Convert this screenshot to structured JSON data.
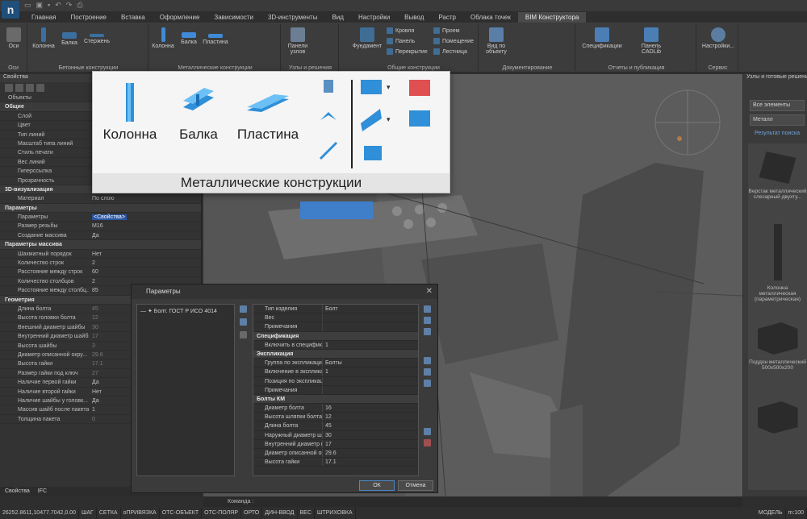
{
  "ribbon": {
    "tabs": [
      "Главная",
      "Построение",
      "Вставка",
      "Оформление",
      "Зависимости",
      "3D-инструменты",
      "Вид",
      "Настройки",
      "Вывод",
      "Растр",
      "Облака точек",
      "BIM Конструктора"
    ],
    "groups": {
      "axes": {
        "btn": "Оси",
        "label": "Оси"
      },
      "concrete": {
        "label": "Бетонные конструкции",
        "btns": [
          "Колонна",
          "Балка",
          "Стержень"
        ]
      },
      "metal": {
        "label": "Металлические конструкции",
        "btns": [
          "Колонна",
          "Балка",
          "Пластина"
        ]
      },
      "nodes": {
        "label": "Узлы и решения",
        "btn": "Панели узлов"
      },
      "general": {
        "label": "Общие конструкции",
        "btn": "Фундамент",
        "items": [
          "Кровля",
          "Проем",
          "Панель",
          "Помещение",
          "Перекрытие",
          "Лестница"
        ]
      },
      "docs": {
        "label": "Документирование",
        "btn": "Вид по объекту"
      },
      "reports": {
        "label": "Отчеты и публикация",
        "btns": [
          "Спецификации",
          "Панель CADLib"
        ]
      },
      "service": {
        "label": "Сервис",
        "btn": "Настройки..."
      }
    }
  },
  "props": {
    "title": "Свойства",
    "rows": [
      {
        "k": "Объекты",
        "v": "",
        "type": "top"
      },
      {
        "k": "Общие",
        "v": "",
        "type": "sec"
      },
      {
        "k": "Слой",
        "v": ""
      },
      {
        "k": "Цвет",
        "v": ""
      },
      {
        "k": "Тип линий",
        "v": ""
      },
      {
        "k": "Масштаб типа линий",
        "v": ""
      },
      {
        "k": "Стиль печати",
        "v": ""
      },
      {
        "k": "Вес линий",
        "v": ""
      },
      {
        "k": "Гиперссылка",
        "v": ""
      },
      {
        "k": "Прозрачность",
        "v": "По слою"
      },
      {
        "k": "3D-визуализация",
        "v": "",
        "type": "sec"
      },
      {
        "k": "Материал",
        "v": "По слою"
      },
      {
        "k": "Параметры",
        "v": "",
        "type": "sec"
      },
      {
        "k": "Параметры",
        "v": "<Свойства>",
        "type": "selected"
      },
      {
        "k": "Размер резьбы",
        "v": "M16"
      },
      {
        "k": "Создание массива",
        "v": "Да"
      },
      {
        "k": "Параметры массива",
        "v": "",
        "type": "sec"
      },
      {
        "k": "Шахматный порядок",
        "v": "Нет"
      },
      {
        "k": "Количество строк",
        "v": "2"
      },
      {
        "k": "Расстояние между строк",
        "v": "60"
      },
      {
        "k": "Количество столбцов",
        "v": "2"
      },
      {
        "k": "Расстояние между столбц...",
        "v": "85"
      },
      {
        "k": "Геометрия",
        "v": "",
        "type": "sec"
      },
      {
        "k": "Длина болта",
        "v": "45",
        "dim": true
      },
      {
        "k": "Высота головки болта",
        "v": "12",
        "dim": true
      },
      {
        "k": "Внешний диаметр шайбы",
        "v": "30",
        "dim": true
      },
      {
        "k": "Внутренний диаметр шайбы",
        "v": "17",
        "dim": true
      },
      {
        "k": "Высота шайбы",
        "v": "3",
        "dim": true
      },
      {
        "k": "Диаметр описанной окру...",
        "v": "29.6",
        "dim": true
      },
      {
        "k": "Высота гайки",
        "v": "17.1",
        "dim": true
      },
      {
        "k": "Размер гайки под ключ",
        "v": "27",
        "dim": true
      },
      {
        "k": "Наличие первой гайки",
        "v": "Да"
      },
      {
        "k": "Наличие второй гайки",
        "v": "Нет"
      },
      {
        "k": "Наличие шайбы у головк...",
        "v": "Да"
      },
      {
        "k": "Массив шайб после пакета",
        "v": "1"
      },
      {
        "k": "Толщина пакета",
        "v": "0",
        "dim": true
      }
    ],
    "tabs": [
      "Свойства",
      "IFC"
    ]
  },
  "callout": {
    "btns": [
      "Колонна",
      "Балка",
      "Пластина"
    ],
    "title": "Металлические конструкции"
  },
  "dialog": {
    "title": "Параметры",
    "tree_item": "Болт. ГОСТ Р ИСО 4014",
    "rows": [
      {
        "k": "Тип изделия",
        "v": "Болт"
      },
      {
        "k": "Вес",
        "v": ""
      },
      {
        "k": "Примечания",
        "v": ""
      },
      {
        "k": "Спецификация",
        "v": "",
        "sec": true
      },
      {
        "k": "Включить в спецификаци...",
        "v": "1"
      },
      {
        "k": "Экспликация",
        "v": "",
        "sec": true
      },
      {
        "k": "Группа по экспликации",
        "v": "Болты"
      },
      {
        "k": "Включение в экспликаци...",
        "v": "1"
      },
      {
        "k": "Позиция по экспликаци...",
        "v": ""
      },
      {
        "k": "Примечания",
        "v": ""
      },
      {
        "k": "Болты КМ",
        "v": "",
        "sec": true
      },
      {
        "k": "Диаметр болта",
        "v": "16"
      },
      {
        "k": "Высота шляпки болта",
        "v": "12"
      },
      {
        "k": "Длина болта",
        "v": "45"
      },
      {
        "k": "Наружный диаметр шай...",
        "v": "30"
      },
      {
        "k": "Внутренний диаметр шай...",
        "v": "17"
      },
      {
        "k": "Диаметр описанной окр...",
        "v": "29.6"
      },
      {
        "k": "Высота гайки",
        "v": "17.1"
      }
    ],
    "ok": "ОК",
    "cancel": "Отмена"
  },
  "library": {
    "title": "Узлы и готовые решения",
    "filter1": "Все элементы",
    "filter2": "Металл",
    "result_title": "Результат поиска",
    "items": [
      "Верстак металлический слесарный двухту...",
      "Колонна металлическая (параметрическая)",
      "Поддон металлический 500х500х200",
      ""
    ]
  },
  "command": "Команда :",
  "status": {
    "coords": "26252.8611,10477.7042,0.00",
    "items": [
      "ШАГ",
      "СЕТКА",
      "оПРИВЯЗКА",
      "ОТС-ОБЪЕКТ",
      "ОТС-ПОЛЯР",
      "ОРТО",
      "ДИН-ВВОД",
      "ВЕС",
      "ШТРИХОВКА"
    ],
    "model": "МОДЕЛЬ",
    "scale": "m:100"
  }
}
